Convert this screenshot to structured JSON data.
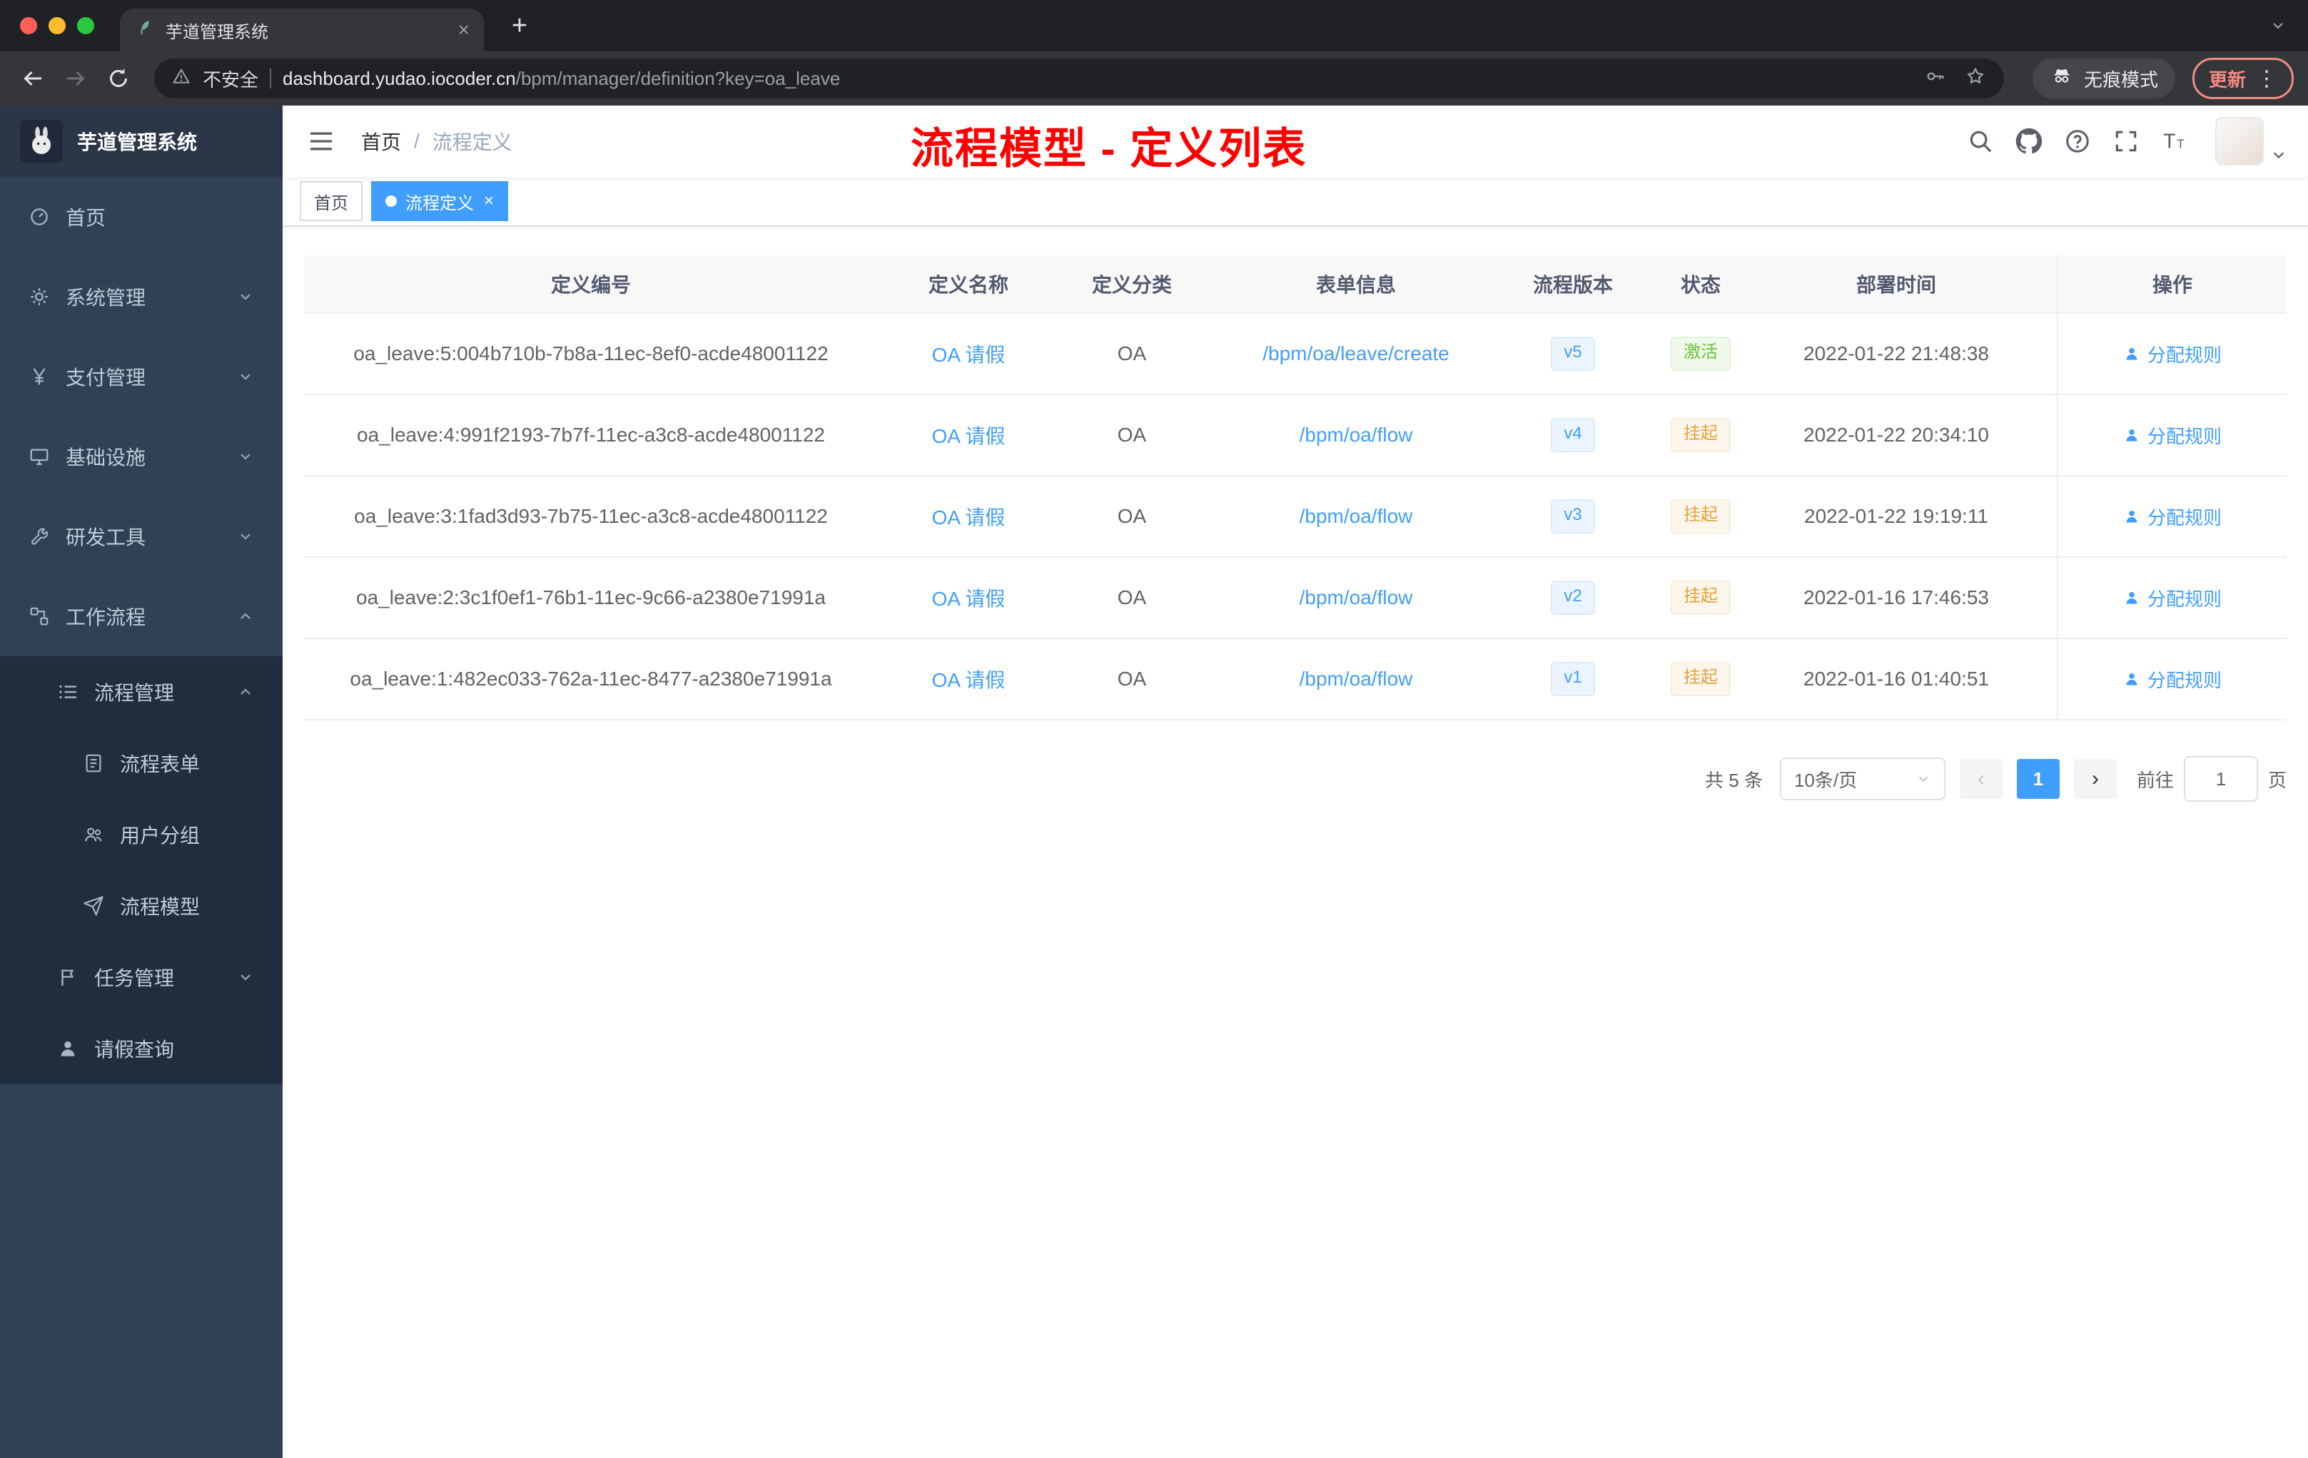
{
  "browser": {
    "tab_title": "芋道管理系统",
    "security_label": "不安全",
    "url_host": "dashboard.yudao.iocoder.cn",
    "url_path": "/bpm/manager/definition?key=oa_leave",
    "incognito_label": "无痕模式",
    "update_label": "更新"
  },
  "sidebar": {
    "logo_title": "芋道管理系统",
    "items": [
      {
        "label": "首页"
      },
      {
        "label": "系统管理"
      },
      {
        "label": "支付管理"
      },
      {
        "label": "基础设施"
      },
      {
        "label": "研发工具"
      },
      {
        "label": "工作流程"
      },
      {
        "label": "流程管理"
      },
      {
        "label": "流程表单"
      },
      {
        "label": "用户分组"
      },
      {
        "label": "流程模型"
      },
      {
        "label": "任务管理"
      },
      {
        "label": "请假查询"
      }
    ]
  },
  "header": {
    "breadcrumb_home": "首页",
    "breadcrumb_separator": "/",
    "breadcrumb_current": "流程定义",
    "annotation": "流程模型 - 定义列表",
    "annotation_color": "#ff0000"
  },
  "tags": {
    "home": "首页",
    "active": "流程定义"
  },
  "table": {
    "columns": [
      "定义编号",
      "定义名称",
      "定义分类",
      "表单信息",
      "流程版本",
      "状态",
      "部署时间",
      "操作"
    ],
    "rows": [
      {
        "id": "oa_leave:5:004b710b-7b8a-11ec-8ef0-acde48001122",
        "name": "OA 请假",
        "category": "OA",
        "form": "/bpm/oa/leave/create",
        "version": "v5",
        "status": {
          "label": "激活",
          "type": "success"
        },
        "time": "2022-01-22 21:48:38",
        "action": "分配规则"
      },
      {
        "id": "oa_leave:4:991f2193-7b7f-11ec-a3c8-acde48001122",
        "name": "OA 请假",
        "category": "OA",
        "form": "/bpm/oa/flow",
        "version": "v4",
        "status": {
          "label": "挂起",
          "type": "warning"
        },
        "time": "2022-01-22 20:34:10",
        "action": "分配规则"
      },
      {
        "id": "oa_leave:3:1fad3d93-7b75-11ec-a3c8-acde48001122",
        "name": "OA 请假",
        "category": "OA",
        "form": "/bpm/oa/flow",
        "version": "v3",
        "status": {
          "label": "挂起",
          "type": "warning"
        },
        "time": "2022-01-22 19:19:11",
        "action": "分配规则"
      },
      {
        "id": "oa_leave:2:3c1f0ef1-76b1-11ec-9c66-a2380e71991a",
        "name": "OA 请假",
        "category": "OA",
        "form": "/bpm/oa/flow",
        "version": "v2",
        "status": {
          "label": "挂起",
          "type": "warning"
        },
        "time": "2022-01-16 17:46:53",
        "action": "分配规则"
      },
      {
        "id": "oa_leave:1:482ec033-762a-11ec-8477-a2380e71991a",
        "name": "OA 请假",
        "category": "OA",
        "form": "/bpm/oa/flow",
        "version": "v1",
        "status": {
          "label": "挂起",
          "type": "warning"
        },
        "time": "2022-01-16 01:40:51",
        "action": "分配规则"
      }
    ]
  },
  "pagination": {
    "total": "共 5 条",
    "page_size": "10条/页",
    "current": "1",
    "goto_label": "前往",
    "goto_value": "1",
    "page_label": "页"
  },
  "colors": {
    "accent": "#409eff",
    "success": "#67c23a",
    "warning": "#e6a23c",
    "sidebar_bg": "#304156",
    "submenu_bg": "#1f2d3d"
  }
}
